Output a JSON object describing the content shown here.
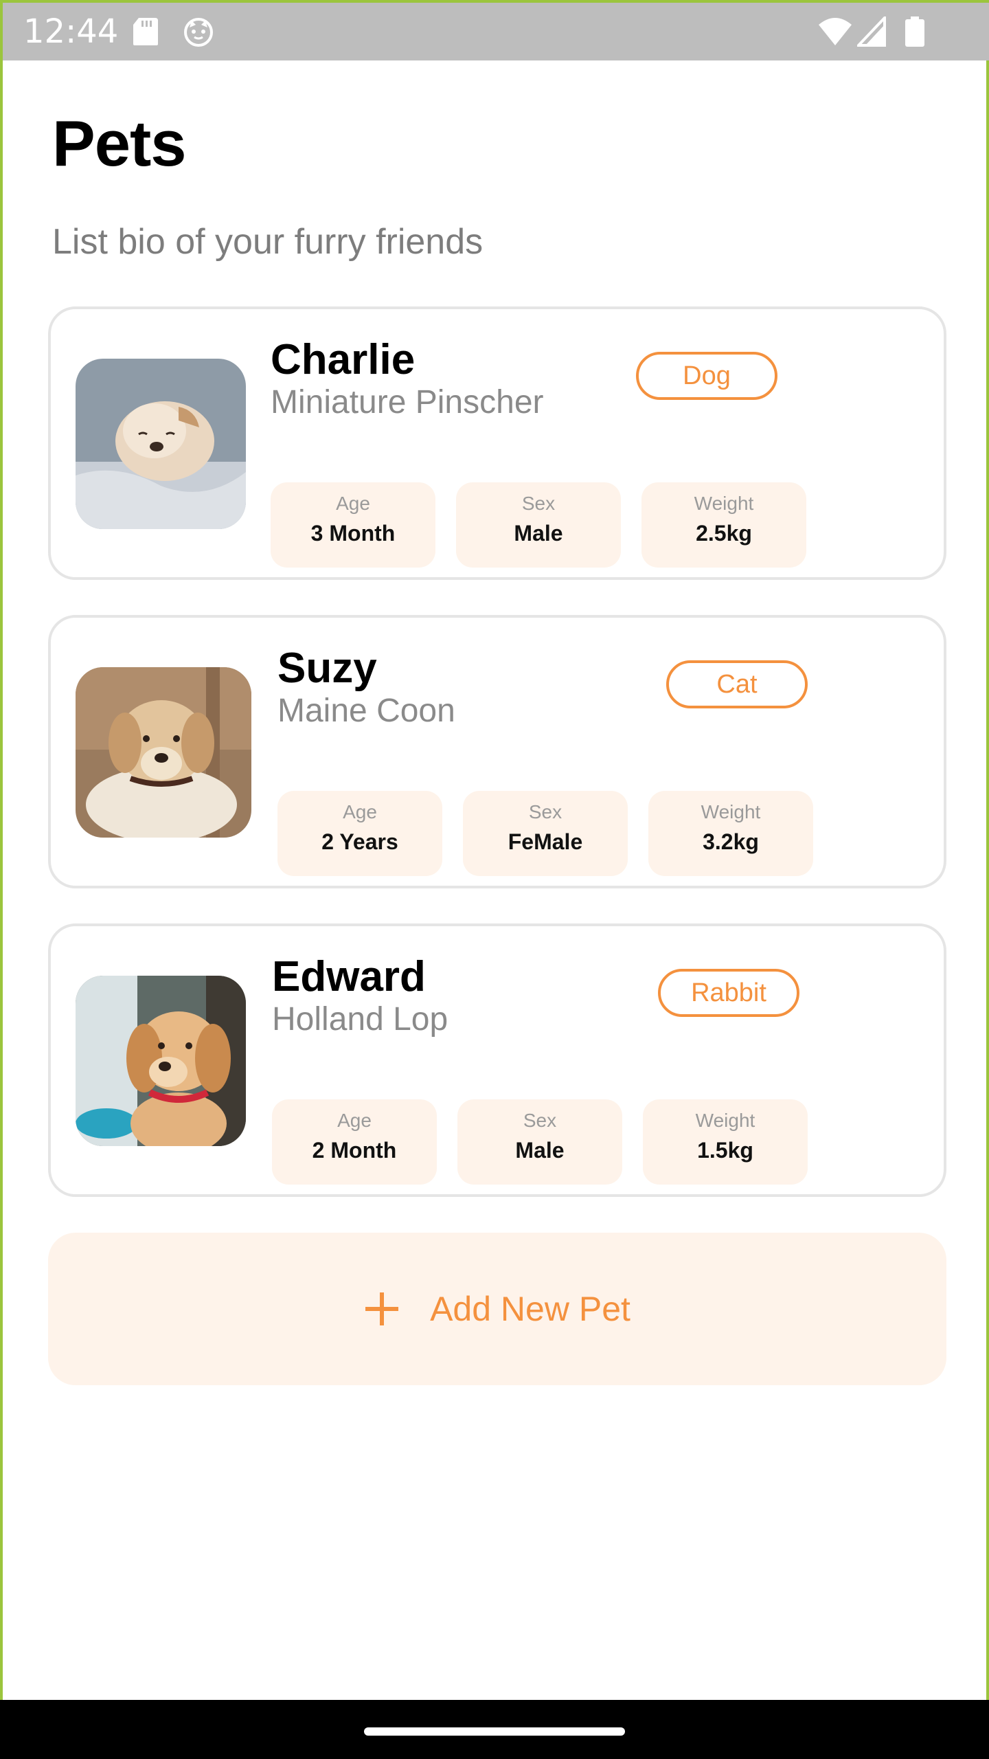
{
  "status_bar": {
    "time": "12:44",
    "icons": [
      "sd-card-icon",
      "cat-face-icon",
      "wifi-icon",
      "signal-icon",
      "battery-icon"
    ]
  },
  "header": {
    "title": "Pets",
    "subtitle": "List bio of your furry friends"
  },
  "labels": {
    "age": "Age",
    "sex": "Sex",
    "weight": "Weight"
  },
  "pets": [
    {
      "name": "Charlie",
      "breed": "Miniature Pinscher",
      "type": "Dog",
      "age": "3 Month",
      "sex": "Male",
      "weight": "2.5kg"
    },
    {
      "name": "Suzy",
      "breed": "Maine Coon",
      "type": "Cat",
      "age": "2 Years",
      "sex": "FeMale",
      "weight": "3.2kg"
    },
    {
      "name": "Edward",
      "breed": "Holland Lop",
      "type": "Rabbit",
      "age": "2 Month",
      "sex": "Male",
      "weight": "1.5kg"
    }
  ],
  "add_button": {
    "label": "Add New Pet"
  },
  "colors": {
    "accent": "#F4913E",
    "stat_bg": "#FEF3EA",
    "card_border": "#E5E5E5",
    "status_bar": "#BDBDBD",
    "frame": "#9BC53D"
  }
}
